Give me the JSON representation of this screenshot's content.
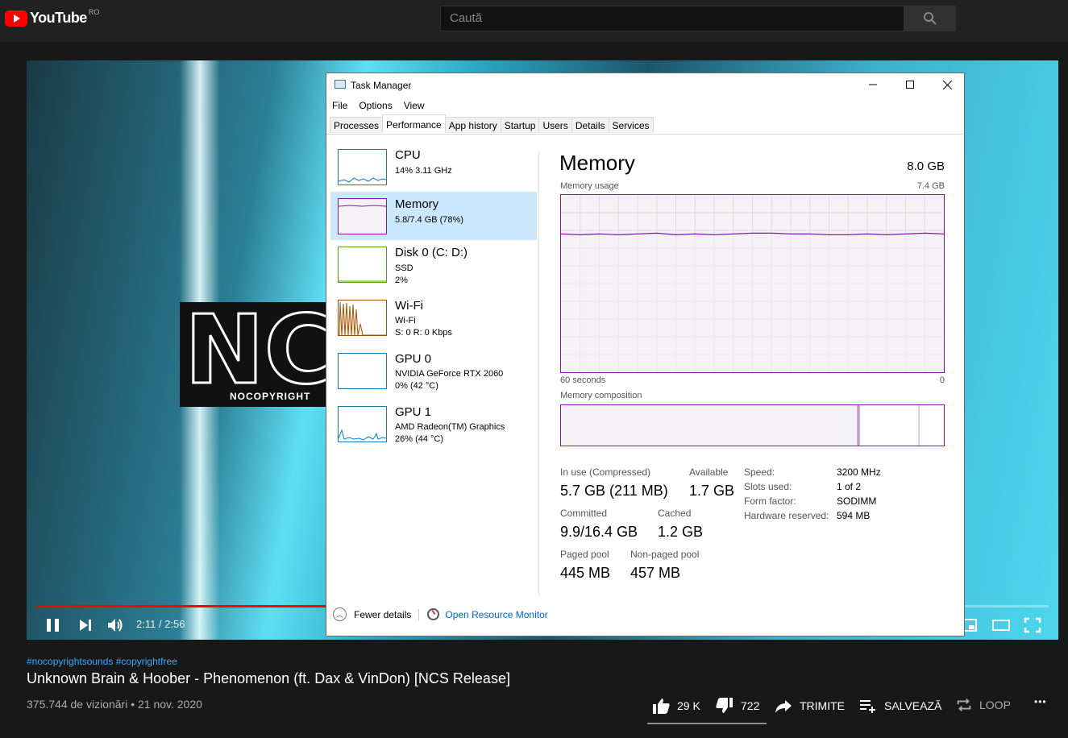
{
  "youtube": {
    "wordmark": "YouTube",
    "region": "RO",
    "search_placeholder": "Caută",
    "player": {
      "time": "2:11 / 2:56",
      "progress_fraction": 0.744
    },
    "video": {
      "tags": "#nocopyrightsounds #copyrightfree",
      "title": "Unknown Brain & Hoober - Phenomenon (ft. Dax & VinDon) [NCS Release]",
      "meta": "375.744 de vizionări • 21 nov. 2020",
      "likes": "29 K",
      "dislikes": "722",
      "share": "TRIMITE",
      "save": "SALVEAZĂ",
      "loop": "LOOP",
      "more": "•••"
    },
    "logo_text": "NC",
    "logo_sub": "NOCOPYRIGHT"
  },
  "tm": {
    "title": "Task Manager",
    "menu": [
      "File",
      "Options",
      "View"
    ],
    "tabs": [
      "Processes",
      "Performance",
      "App history",
      "Startup",
      "Users",
      "Details",
      "Services"
    ],
    "sidebar": [
      {
        "name": "CPU",
        "line1": "14% 3.11 GHz",
        "line2": ""
      },
      {
        "name": "Memory",
        "line1": "5.8/7.4 GB (78%)",
        "line2": ""
      },
      {
        "name": "Disk 0 (C: D:)",
        "line1": "SSD",
        "line2": "2%"
      },
      {
        "name": "Wi-Fi",
        "line1": "Wi-Fi",
        "line2": "S: 0 R: 0 Kbps"
      },
      {
        "name": "GPU 0",
        "line1": "NVIDIA GeForce RTX 2060",
        "line2": "0% (42 °C)"
      },
      {
        "name": "GPU 1",
        "line1": "AMD Radeon(TM) Graphics",
        "line2": "26% (44 °C)"
      }
    ],
    "panel": {
      "title": "Memory",
      "total": "8.0 GB",
      "usage_label": "Memory usage",
      "usage_max": "7.4 GB",
      "axis_left": "60 seconds",
      "axis_right": "0",
      "composition_label": "Memory composition",
      "stats": {
        "in_use_label": "In use (Compressed)",
        "in_use": "5.7 GB (211 MB)",
        "available_label": "Available",
        "available": "1.7 GB",
        "committed_label": "Committed",
        "committed": "9.9/16.4 GB",
        "cached_label": "Cached",
        "cached": "1.2 GB",
        "paged_label": "Paged pool",
        "paged": "445 MB",
        "nonpaged_label": "Non-paged pool",
        "nonpaged": "457 MB"
      },
      "specs": {
        "speed_label": "Speed:",
        "speed": "3200 MHz",
        "slots_label": "Slots used:",
        "slots": "1 of 2",
        "form_label": "Form factor:",
        "form": "SODIMM",
        "reserved_label": "Hardware reserved:",
        "reserved": "594 MB"
      },
      "usage_fraction": 0.78
    },
    "footer": {
      "fewer": "Fewer details",
      "resource": "Open Resource Monitor"
    },
    "colors": {
      "memory": "#8b12ae",
      "cpu": "#117dbb",
      "disk": "#4da60c",
      "wifi": "#a74f01",
      "selected": "#cce8ff"
    }
  }
}
